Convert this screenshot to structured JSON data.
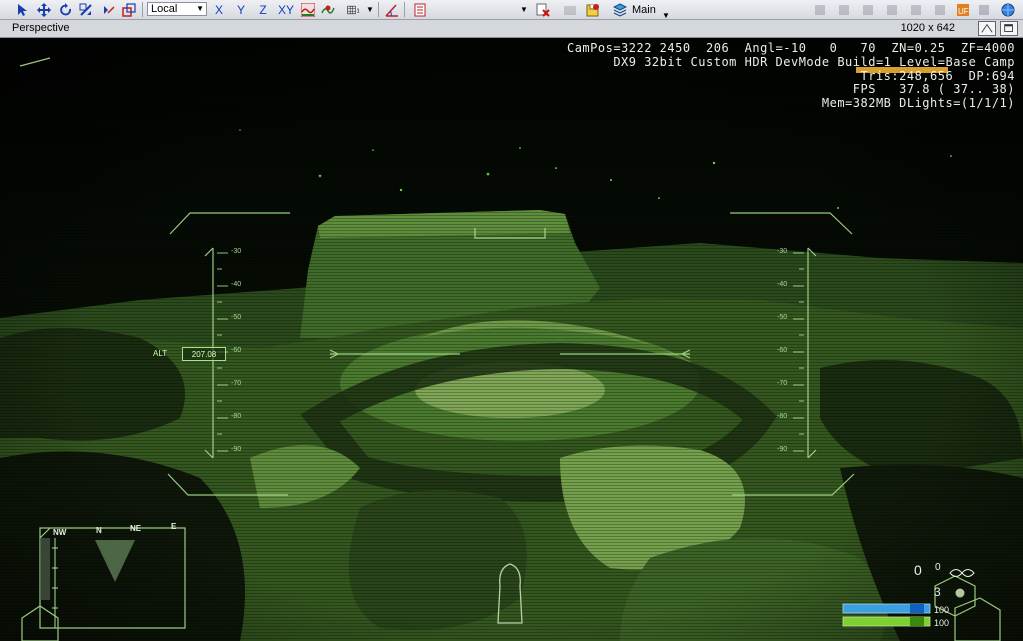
{
  "toolbar": {
    "coord_system": "Local",
    "axes": [
      "X",
      "Y",
      "Z",
      "XY"
    ],
    "layer_label": "Main",
    "tools": [
      "select-icon",
      "move-icon",
      "rotate-icon",
      "scale-icon",
      "link-icon",
      "unlink-icon",
      "terrain-follow-icon",
      "snap-icon",
      "grid-icon",
      "angle-snap-icon",
      "object-list-icon",
      "delete-icon",
      "layer-icon",
      "globe-icon"
    ],
    "colors": {
      "background": "#e4e7ec",
      "accent": "#1040c0"
    }
  },
  "viewport": {
    "title": "Perspective",
    "resolution": "1020 x 642"
  },
  "stats": {
    "line1": "CamPos=3222 2450  206  Angl=-10   0   70  ZN=0.25  ZF=4000",
    "line2": "DX9 32bit Custom HDR DevMode Build=1 Level=Base Camp",
    "line3": "Tris:248,656  DP:694",
    "line4": "FPS   37.8 ( 37.. 38)",
    "line5": "Mem=382MB DLights=(1/1/1)"
  },
  "hud": {
    "alt_label": "ALT",
    "alt_value": "207.08",
    "left_ticks": [
      "-30",
      "-40",
      "-50",
      "-60",
      "-70",
      "-80",
      "-90"
    ],
    "right_ticks": [
      "-30",
      "-40",
      "-50",
      "-60",
      "-70",
      "-80",
      "-90"
    ],
    "compass": [
      "NW",
      "N",
      "NE",
      "E"
    ],
    "ammo_clip": "0",
    "ammo_reserve": "0",
    "grenades": "3",
    "energy": "100",
    "health": "100",
    "colors": {
      "hud_green": "#a9e090",
      "energy_bar": "#3aa0e0",
      "health_bar": "#7ed030"
    }
  }
}
